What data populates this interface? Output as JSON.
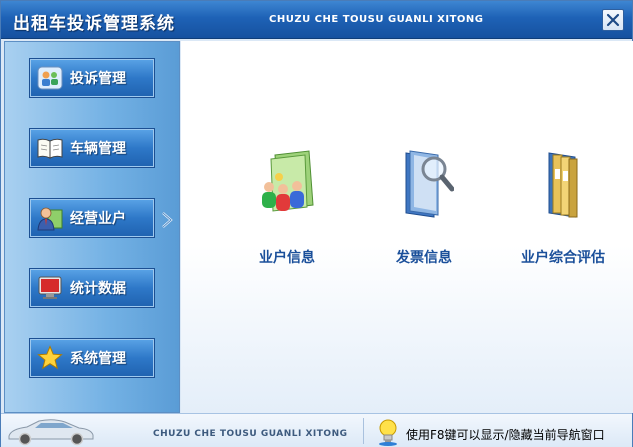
{
  "window": {
    "title": "出租车投诉管理系统",
    "subtitle": "CHUZU CHE TOUSU GUANLI XITONG",
    "close_icon": "close-icon"
  },
  "sidebar": {
    "items": [
      {
        "label": "投诉管理",
        "icon": "complaint-users-icon"
      },
      {
        "label": "车辆管理",
        "icon": "book-icon"
      },
      {
        "label": "经营业户",
        "icon": "operator-person-icon",
        "selected": true
      },
      {
        "label": "统计数据",
        "icon": "monitor-icon"
      },
      {
        "label": "系统管理",
        "icon": "star-icon"
      }
    ],
    "selected_indicator_icon": "chevron-right-icon"
  },
  "main": {
    "tiles": [
      {
        "label": "业户信息",
        "icon": "people-folder-icon"
      },
      {
        "label": "发票信息",
        "icon": "magnifier-folder-icon"
      },
      {
        "label": "业户综合评估",
        "icon": "binders-icon"
      }
    ]
  },
  "status": {
    "brand": "CHUZU CHE TOUSU GUANLI XITONG",
    "hint": "使用F8键可以显示/隐藏当前导航窗口",
    "car_icon": "car-icon",
    "hint_icon": "lightbulb-icon"
  },
  "colors": {
    "titlebar": "#1e62b6",
    "nav_button": "#2e78c8",
    "tile_label": "#1a4f9a"
  }
}
